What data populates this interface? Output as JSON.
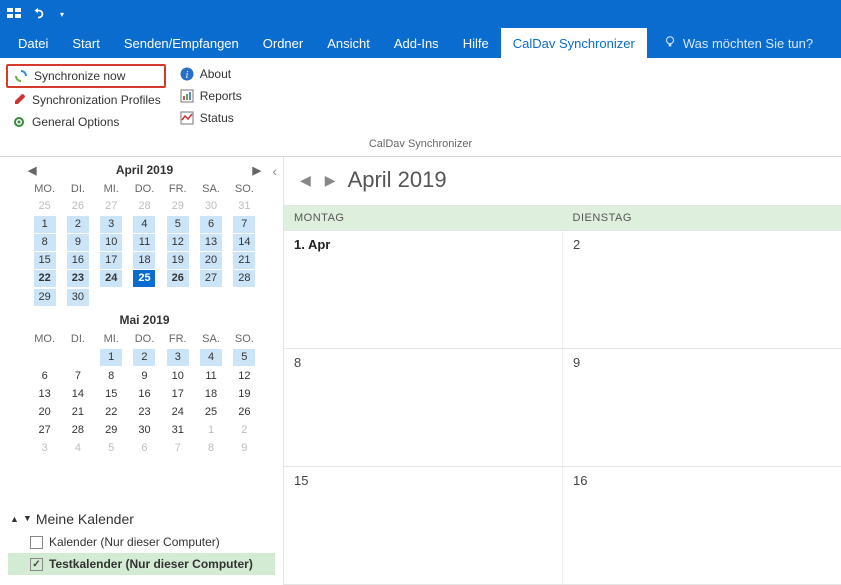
{
  "titlebar": {
    "qat_dropdown": "▾"
  },
  "menubar": {
    "items": [
      "Datei",
      "Start",
      "Senden/Empfangen",
      "Ordner",
      "Ansicht",
      "Add-Ins",
      "Hilfe",
      "CalDav Synchronizer"
    ],
    "active_index": 7,
    "tell_me": "Was möchten Sie tun?"
  },
  "ribbon": {
    "col1": {
      "sync_now": "Synchronize now",
      "profiles": "Synchronization Profiles",
      "general": "General Options"
    },
    "col2": {
      "about": "About",
      "reports": "Reports",
      "status": "Status"
    },
    "group_label": "CalDav Synchronizer"
  },
  "minicals": {
    "dow": [
      "MO.",
      "DI.",
      "MI.",
      "DO.",
      "FR.",
      "SA.",
      "SO."
    ],
    "april": {
      "title": "April 2019",
      "weeks": [
        [
          {
            "d": "25",
            "cls": "dim"
          },
          {
            "d": "26",
            "cls": "dim"
          },
          {
            "d": "27",
            "cls": "dim"
          },
          {
            "d": "28",
            "cls": "dim"
          },
          {
            "d": "29",
            "cls": "dim"
          },
          {
            "d": "30",
            "cls": "dim"
          },
          {
            "d": "31",
            "cls": "dim"
          }
        ],
        [
          {
            "d": "1",
            "cls": "range"
          },
          {
            "d": "2",
            "cls": "range"
          },
          {
            "d": "3",
            "cls": "range"
          },
          {
            "d": "4",
            "cls": "range"
          },
          {
            "d": "5",
            "cls": "range"
          },
          {
            "d": "6",
            "cls": "range"
          },
          {
            "d": "7",
            "cls": "range"
          }
        ],
        [
          {
            "d": "8",
            "cls": "range"
          },
          {
            "d": "9",
            "cls": "range"
          },
          {
            "d": "10",
            "cls": "range"
          },
          {
            "d": "11",
            "cls": "range"
          },
          {
            "d": "12",
            "cls": "range"
          },
          {
            "d": "13",
            "cls": "range"
          },
          {
            "d": "14",
            "cls": "range"
          }
        ],
        [
          {
            "d": "15",
            "cls": "range"
          },
          {
            "d": "16",
            "cls": "range"
          },
          {
            "d": "17",
            "cls": "range"
          },
          {
            "d": "18",
            "cls": "range"
          },
          {
            "d": "19",
            "cls": "range"
          },
          {
            "d": "20",
            "cls": "range"
          },
          {
            "d": "21",
            "cls": "range"
          }
        ],
        [
          {
            "d": "22",
            "cls": "rangebold"
          },
          {
            "d": "23",
            "cls": "rangebold"
          },
          {
            "d": "24",
            "cls": "rangebold"
          },
          {
            "d": "25",
            "cls": "today"
          },
          {
            "d": "26",
            "cls": "rangebold"
          },
          {
            "d": "27",
            "cls": "range"
          },
          {
            "d": "28",
            "cls": "range"
          }
        ],
        [
          {
            "d": "29",
            "cls": "range"
          },
          {
            "d": "30",
            "cls": "range"
          },
          {
            "d": "",
            "cls": ""
          },
          {
            "d": "",
            "cls": ""
          },
          {
            "d": "",
            "cls": ""
          },
          {
            "d": "",
            "cls": ""
          },
          {
            "d": "",
            "cls": ""
          }
        ]
      ]
    },
    "may": {
      "title": "Mai 2019",
      "weeks": [
        [
          {
            "d": "",
            "cls": ""
          },
          {
            "d": "",
            "cls": ""
          },
          {
            "d": "1",
            "cls": "mayrange"
          },
          {
            "d": "2",
            "cls": "mayrange"
          },
          {
            "d": "3",
            "cls": "mayrange"
          },
          {
            "d": "4",
            "cls": "mayrange"
          },
          {
            "d": "5",
            "cls": "mayrange"
          }
        ],
        [
          {
            "d": "6",
            "cls": ""
          },
          {
            "d": "7",
            "cls": ""
          },
          {
            "d": "8",
            "cls": ""
          },
          {
            "d": "9",
            "cls": ""
          },
          {
            "d": "10",
            "cls": ""
          },
          {
            "d": "11",
            "cls": ""
          },
          {
            "d": "12",
            "cls": ""
          }
        ],
        [
          {
            "d": "13",
            "cls": ""
          },
          {
            "d": "14",
            "cls": ""
          },
          {
            "d": "15",
            "cls": ""
          },
          {
            "d": "16",
            "cls": ""
          },
          {
            "d": "17",
            "cls": ""
          },
          {
            "d": "18",
            "cls": ""
          },
          {
            "d": "19",
            "cls": ""
          }
        ],
        [
          {
            "d": "20",
            "cls": ""
          },
          {
            "d": "21",
            "cls": ""
          },
          {
            "d": "22",
            "cls": ""
          },
          {
            "d": "23",
            "cls": ""
          },
          {
            "d": "24",
            "cls": ""
          },
          {
            "d": "25",
            "cls": ""
          },
          {
            "d": "26",
            "cls": ""
          }
        ],
        [
          {
            "d": "27",
            "cls": ""
          },
          {
            "d": "28",
            "cls": ""
          },
          {
            "d": "29",
            "cls": ""
          },
          {
            "d": "30",
            "cls": ""
          },
          {
            "d": "31",
            "cls": ""
          },
          {
            "d": "1",
            "cls": "dim"
          },
          {
            "d": "2",
            "cls": "dim"
          }
        ],
        [
          {
            "d": "3",
            "cls": "dim"
          },
          {
            "d": "4",
            "cls": "dim"
          },
          {
            "d": "5",
            "cls": "dim"
          },
          {
            "d": "6",
            "cls": "dim"
          },
          {
            "d": "7",
            "cls": "dim"
          },
          {
            "d": "8",
            "cls": "dim"
          },
          {
            "d": "9",
            "cls": "dim"
          }
        ]
      ]
    }
  },
  "calendars": {
    "header": "Meine Kalender",
    "items": [
      {
        "label": "Kalender (Nur dieser Computer)",
        "checked": false,
        "active": false
      },
      {
        "label": "Testkalender (Nur dieser Computer)",
        "checked": true,
        "active": true
      }
    ]
  },
  "main": {
    "title": "April 2019",
    "day_headers": [
      "MONTAG",
      "DIENSTAG"
    ],
    "weeks": [
      [
        {
          "label": "1. Apr",
          "first": true
        },
        {
          "label": "2",
          "first": false
        }
      ],
      [
        {
          "label": "8",
          "first": false
        },
        {
          "label": "9",
          "first": false
        }
      ],
      [
        {
          "label": "15",
          "first": false
        },
        {
          "label": "16",
          "first": false
        }
      ]
    ]
  }
}
